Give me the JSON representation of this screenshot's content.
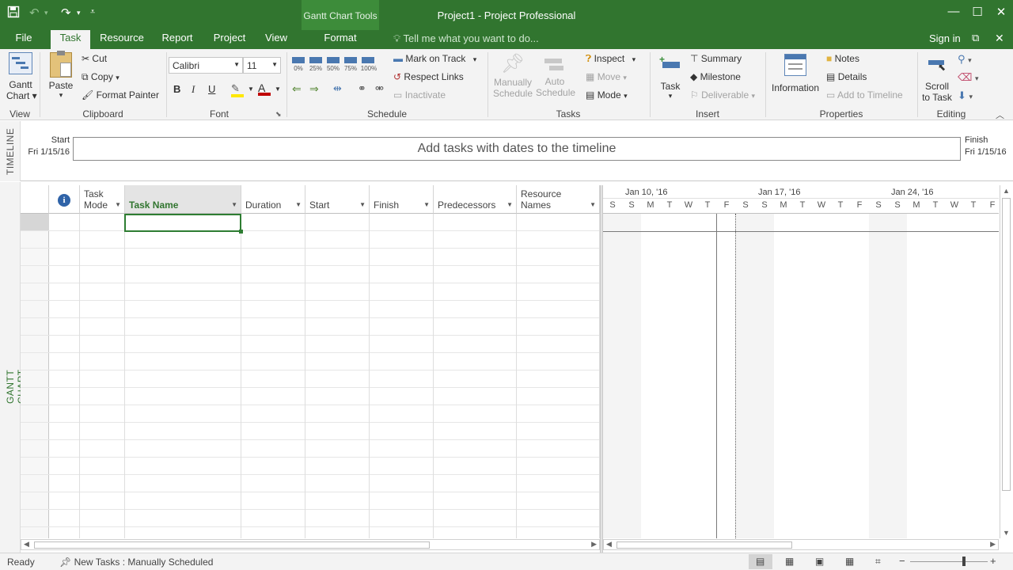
{
  "titlebar": {
    "contextual_label": "Gantt Chart Tools",
    "window_title": "Project1 - Project Professional"
  },
  "tabs": [
    "File",
    "Task",
    "Resource",
    "Report",
    "Project",
    "View",
    "Format"
  ],
  "active_tab": "Task",
  "tell_me": "Tell me what you want to do...",
  "sign_in": "Sign in",
  "ribbon": {
    "view": {
      "gantt_line1": "Gantt",
      "gantt_line2": "Chart",
      "group": "View"
    },
    "clipboard": {
      "paste": "Paste",
      "cut": "Cut",
      "copy": "Copy",
      "format_painter": "Format Painter",
      "group": "Clipboard"
    },
    "font": {
      "family": "Calibri",
      "size": "11",
      "bold": "B",
      "italic": "I",
      "underline": "U",
      "group": "Font"
    },
    "schedule": {
      "percents": [
        "0%",
        "25%",
        "50%",
        "75%",
        "100%"
      ],
      "mark_on_track": "Mark on Track",
      "respect_links": "Respect Links",
      "inactivate": "Inactivate",
      "group": "Schedule"
    },
    "tasks": {
      "manually_1": "Manually",
      "manually_2": "Schedule",
      "auto_1": "Auto",
      "auto_2": "Schedule",
      "inspect": "Inspect",
      "move": "Move",
      "mode": "Mode",
      "group": "Tasks"
    },
    "insert": {
      "task": "Task",
      "summary": "Summary",
      "milestone": "Milestone",
      "deliverable": "Deliverable",
      "group": "Insert"
    },
    "properties": {
      "information": "Information",
      "notes": "Notes",
      "details": "Details",
      "add_to_timeline": "Add to Timeline",
      "group": "Properties"
    },
    "editing": {
      "scroll_1": "Scroll",
      "scroll_2": "to Task",
      "group": "Editing"
    }
  },
  "timeline": {
    "side_label": "TIMELINE",
    "start_label": "Start",
    "start_date": "Fri 1/15/16",
    "finish_label": "Finish",
    "finish_date": "Fri 1/15/16",
    "placeholder": "Add tasks with dates to the timeline"
  },
  "gantt_side_label": "GANTT CHART",
  "columns": [
    {
      "line1": "Task",
      "line2": "Mode"
    },
    {
      "line1": "",
      "line2": "Task Name"
    },
    {
      "line1": "",
      "line2": "Duration"
    },
    {
      "line1": "",
      "line2": "Start"
    },
    {
      "line1": "",
      "line2": "Finish"
    },
    {
      "line1": "",
      "line2": "Predecessors"
    },
    {
      "line1": "Resource",
      "line2": "Names"
    }
  ],
  "chart": {
    "weeks": [
      "Jan 10, '16",
      "Jan 17, '16",
      "Jan 24, '16"
    ],
    "days": [
      "S",
      "S",
      "M",
      "T",
      "W",
      "T",
      "F",
      "S",
      "S",
      "M",
      "T",
      "W",
      "T",
      "F",
      "S",
      "S",
      "M",
      "T",
      "W",
      "T",
      "F"
    ]
  },
  "status": {
    "ready": "Ready",
    "new_tasks": "New Tasks : Manually Scheduled"
  },
  "colors": {
    "accent": "#31752f",
    "contextual": "#3d8c3a"
  }
}
